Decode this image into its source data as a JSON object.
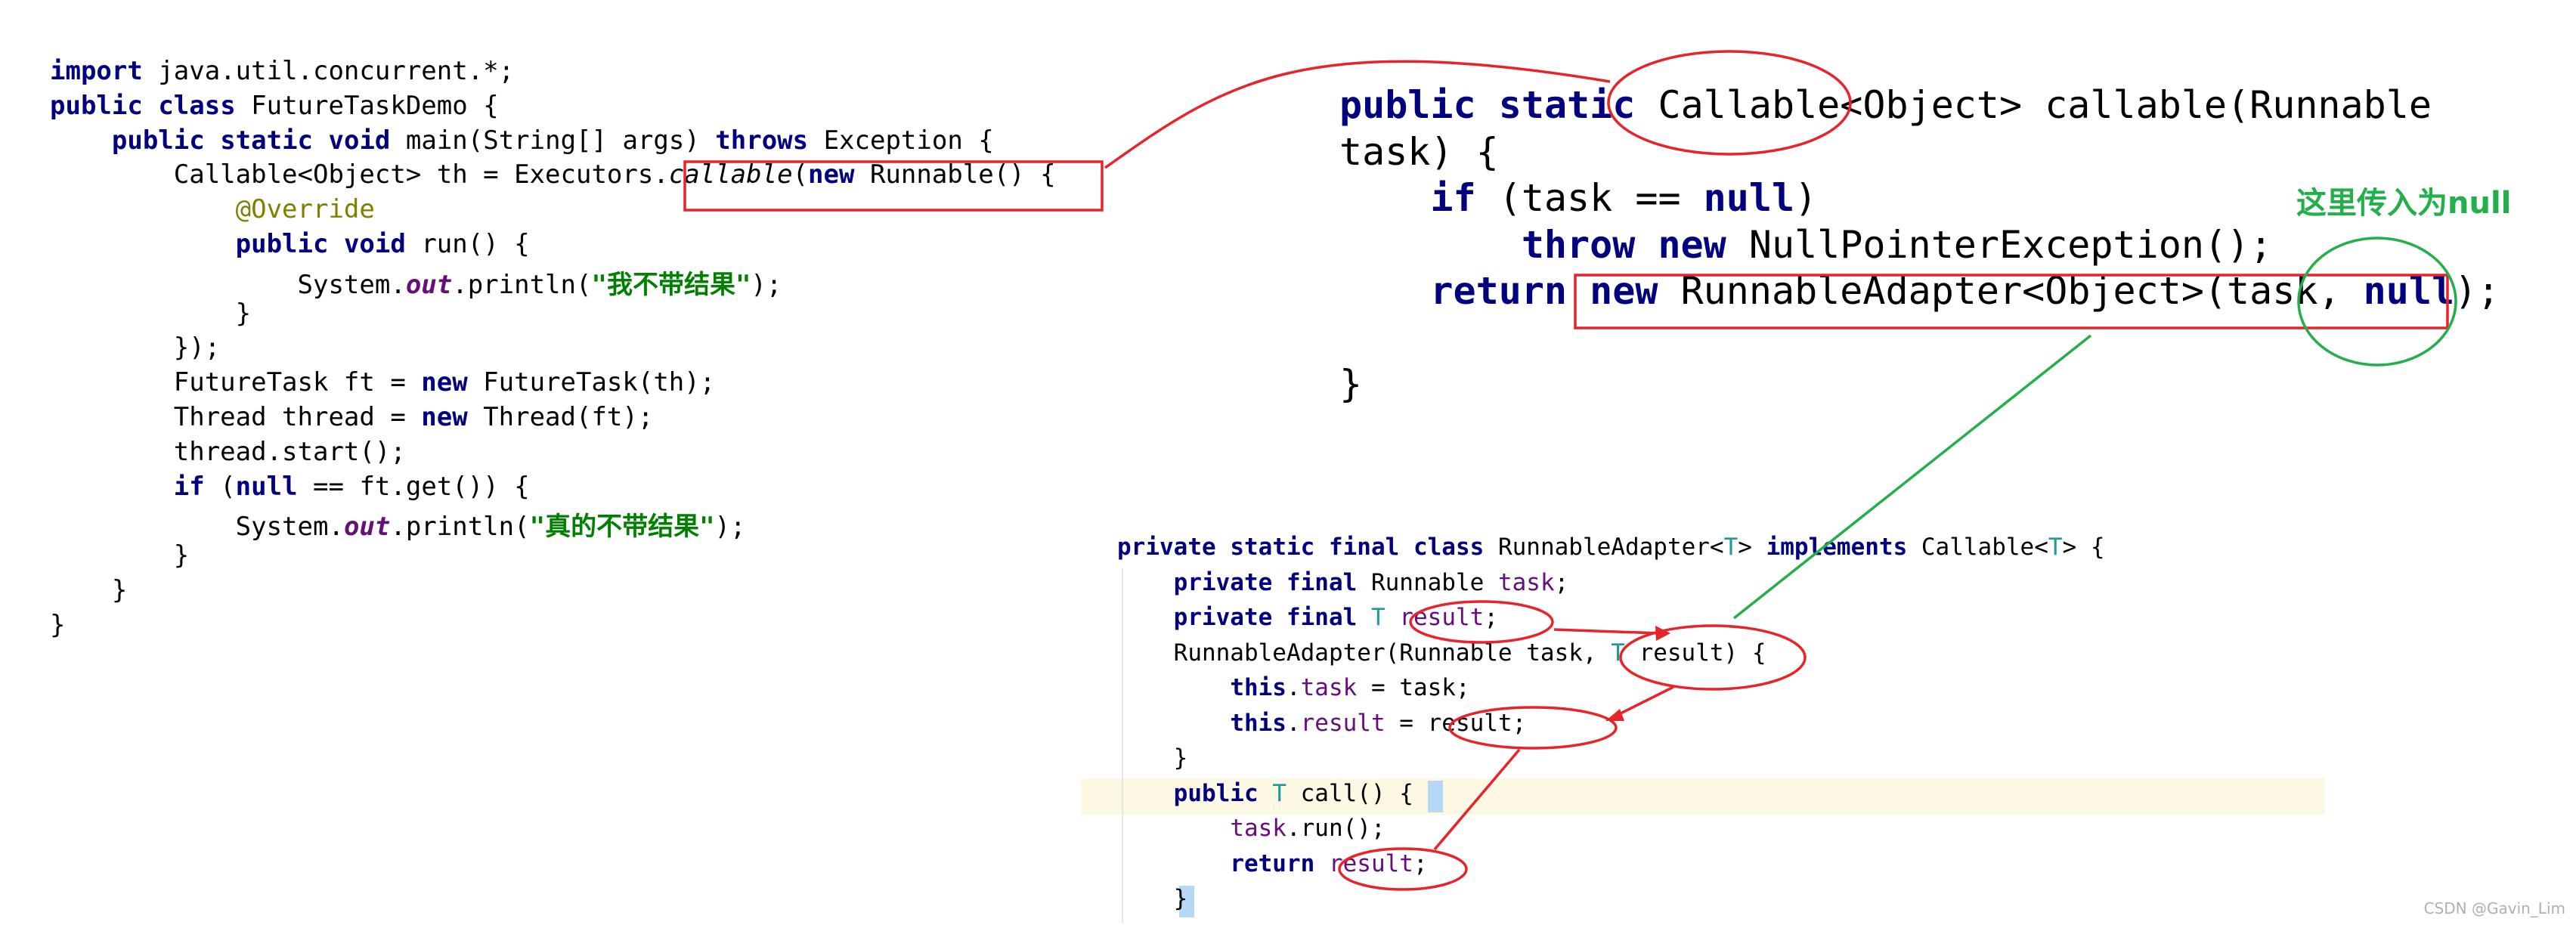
{
  "left_code": [
    "import java.util.concurrent.*;",
    "public class FutureTaskDemo {",
    "    public static void main(String[] args) throws Exception {",
    "        Callable<Object> th = Executors.callable(new Runnable() {",
    "            @Override",
    "            public void run() {",
    "                System.out.println(\"我不带结果\");",
    "            }",
    "        });",
    "        FutureTask ft = new FutureTask(th);",
    "        Thread thread = new Thread(ft);",
    "        thread.start();",
    "        if (null == ft.get()) {",
    "            System.out.println(\"真的不带结果\");",
    "        }",
    "    }",
    "}"
  ],
  "top_code": [
    "public static Callable<Object> callable(Runnable",
    "task) {",
    "    if (task == null)",
    "        throw new NullPointerException();",
    "    return new RunnableAdapter<Object>(task, null);",
    "",
    "}"
  ],
  "bottom_code": [
    "private static final class RunnableAdapter<T> implements Callable<T> {",
    "    private final Runnable task;",
    "    private final T result;",
    "    RunnableAdapter(Runnable task, T result) {",
    "        this.task = task;",
    "        this.result = result;",
    "    }",
    "    public T call() {",
    "        task.run();",
    "        return result;",
    "    }"
  ],
  "annotation": "这里传入为null",
  "watermark": "CSDN @Gavin_Lim",
  "colors": {
    "keyword": "#000080",
    "string": "#008000",
    "annotation": "#808000",
    "type_param": "#20999d",
    "field": "#660e7a",
    "red_markup": "#e8232a",
    "green_markup": "#23b04a",
    "highlight_band": "#fdf8e3"
  }
}
